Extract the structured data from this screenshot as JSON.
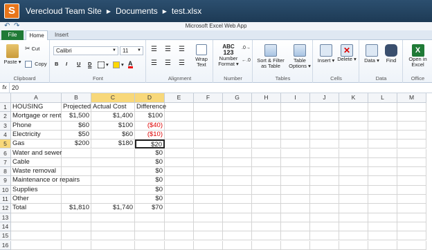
{
  "titlebar": {
    "logo": "S",
    "crumbs": [
      "Verecloud Team Site",
      "Documents",
      "test.xlsx"
    ]
  },
  "quick": {
    "app_title": "Microsoft Excel Web App"
  },
  "tabs": [
    "File",
    "Home",
    "Insert"
  ],
  "ribbon": {
    "clipboard": {
      "paste": "Paste",
      "cut": "Cut",
      "copy": "Copy",
      "label": "Clipboard"
    },
    "font": {
      "name": "Calibri",
      "size": "11",
      "bold": "B",
      "italic": "I",
      "underline": "U",
      "double_underline": "D",
      "font_color": "A",
      "label": "Font"
    },
    "alignment": {
      "wrap": "Wrap",
      "wrap2": "Text",
      "label": "Alignment"
    },
    "number": {
      "abc": "ABC",
      "n123": "123",
      "fmt": "Number",
      "fmt2": "Format",
      "label": "Number"
    },
    "tables": {
      "sort": "Sort & Filter",
      "sort2": "as Table",
      "opts": "Table",
      "opts2": "Options",
      "label": "Tables"
    },
    "cells": {
      "insert": "Insert",
      "delete": "Delete",
      "label": "Cells"
    },
    "data": {
      "data": "Data",
      "find": "Find",
      "label": "Data"
    },
    "office": {
      "open": "Open in",
      "open2": "Excel",
      "label": "Office"
    }
  },
  "formula_bar": {
    "fx": "fx",
    "value": "20"
  },
  "columns": [
    "A",
    "B",
    "C",
    "D",
    "E",
    "F",
    "G",
    "H",
    "I",
    "J",
    "K",
    "L",
    "M"
  ],
  "rows": [
    [
      "HOUSING",
      "Projected",
      "Actual Cost",
      "Difference"
    ],
    [
      "Mortgage or rent",
      "$1,500",
      "$1,400",
      "$100"
    ],
    [
      "Phone",
      "$60",
      "$100",
      "($40)"
    ],
    [
      "Electricity",
      "$50",
      "$60",
      "($10)"
    ],
    [
      "Gas",
      "$200",
      "$180",
      "$20"
    ],
    [
      "Water and sewer",
      "",
      "",
      "$0"
    ],
    [
      "Cable",
      "",
      "",
      "$0"
    ],
    [
      "Waste removal",
      "",
      "",
      "$0"
    ],
    [
      "Maintenance or repairs",
      "",
      "",
      "$0"
    ],
    [
      "Supplies",
      "",
      "",
      "$0"
    ],
    [
      "Other",
      "",
      "",
      "$0"
    ],
    [
      "Total",
      "$1,810",
      "$1,740",
      "$70"
    ],
    [
      "",
      "",
      "",
      ""
    ],
    [
      "",
      "",
      "",
      ""
    ],
    [
      "",
      "",
      "",
      ""
    ],
    [
      "",
      "",
      "",
      ""
    ]
  ],
  "colors": {
    "negative": "#dd0000",
    "selection": "#f8d87a",
    "file_tab": "#1f7a36",
    "title_bar": "#2c4f6f"
  }
}
